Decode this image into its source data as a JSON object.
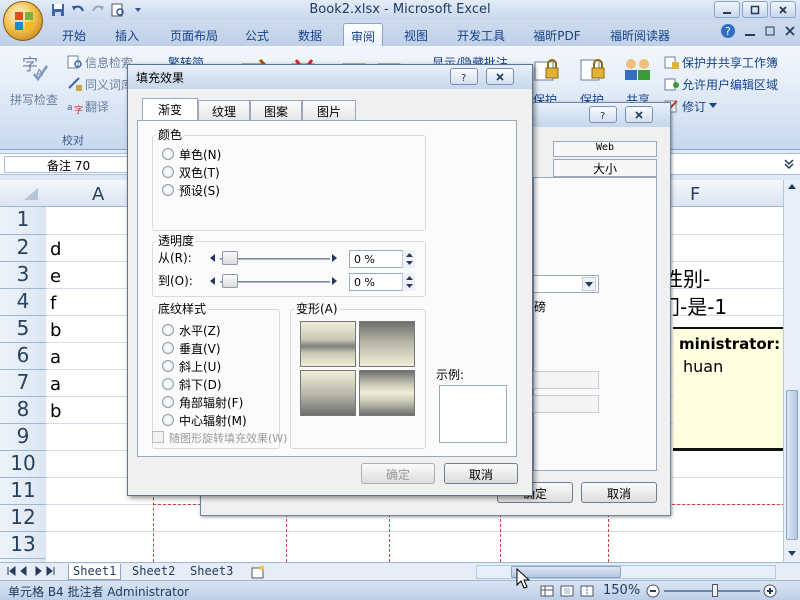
{
  "window": {
    "title": "Book2.xlsx - Microsoft Excel"
  },
  "ribbon_tabs": [
    "开始",
    "插入",
    "页面布局",
    "公式",
    "数据",
    "审阅",
    "视图",
    "开发工具",
    "福昕PDF",
    "福昕阅读器"
  ],
  "active_tab": "审阅",
  "ribbon": {
    "spell_check": "拼写检查",
    "info_search": "信息检索",
    "thesaurus": "同义词库",
    "translate": "翻译",
    "simplified": "繁转简",
    "show_comments": "显示/隐藏批注",
    "proofing_group": "校对",
    "protect_share": "保护并共享工作簿",
    "allow_edit": "允许用户编辑区域",
    "revisions": "修订",
    "protect1": "保护",
    "protect2": "保护",
    "share": "共享"
  },
  "formula_bar": {
    "namebox": "备注 70"
  },
  "columns": [
    "A",
    "F"
  ],
  "rows": [
    "1",
    "2",
    "3",
    "4",
    "5",
    "6",
    "7",
    "8",
    "9",
    "10",
    "11",
    "12",
    "13"
  ],
  "cells": {
    "A2": "d",
    "A3": "e",
    "A4": "f",
    "A5": "b",
    "A6": "a",
    "A7": "a",
    "A8": "b"
  },
  "comment": {
    "line1": "性别-",
    "line2": "门-是-1",
    "author": "ministrator:",
    "name": "huan"
  },
  "sheets": [
    "Sheet1",
    "Sheet2",
    "Sheet3"
  ],
  "status": {
    "text": "单元格 B4 批注者 Administrator",
    "zoom": "150%"
  },
  "back_dialog": {
    "tab_web": "Web",
    "tab_size": "大小",
    "fragment": "磅",
    "ok": "确定",
    "cancel": "取消"
  },
  "fill_dialog": {
    "title": "填充效果",
    "tabs": [
      "渐变",
      "纹理",
      "图案",
      "图片"
    ],
    "active_tab": "渐变",
    "colors_label": "颜色",
    "color_options": [
      "单色(N)",
      "双色(T)",
      "预设(S)"
    ],
    "transparency_label": "透明度",
    "from_label": "从(R):",
    "to_label": "到(O):",
    "from_value": "0 %",
    "to_value": "0 %",
    "shading_label": "底纹样式",
    "shading_options": [
      "水平(Z)",
      "垂直(V)",
      "斜上(U)",
      "斜下(D)",
      "角部辐射(F)",
      "中心辐射(M)"
    ],
    "variants_label": "变形(A)",
    "sample_label": "示例:",
    "rotate_label": "随图形旋转填充效果(W)",
    "ok": "确定",
    "cancel": "取消"
  }
}
